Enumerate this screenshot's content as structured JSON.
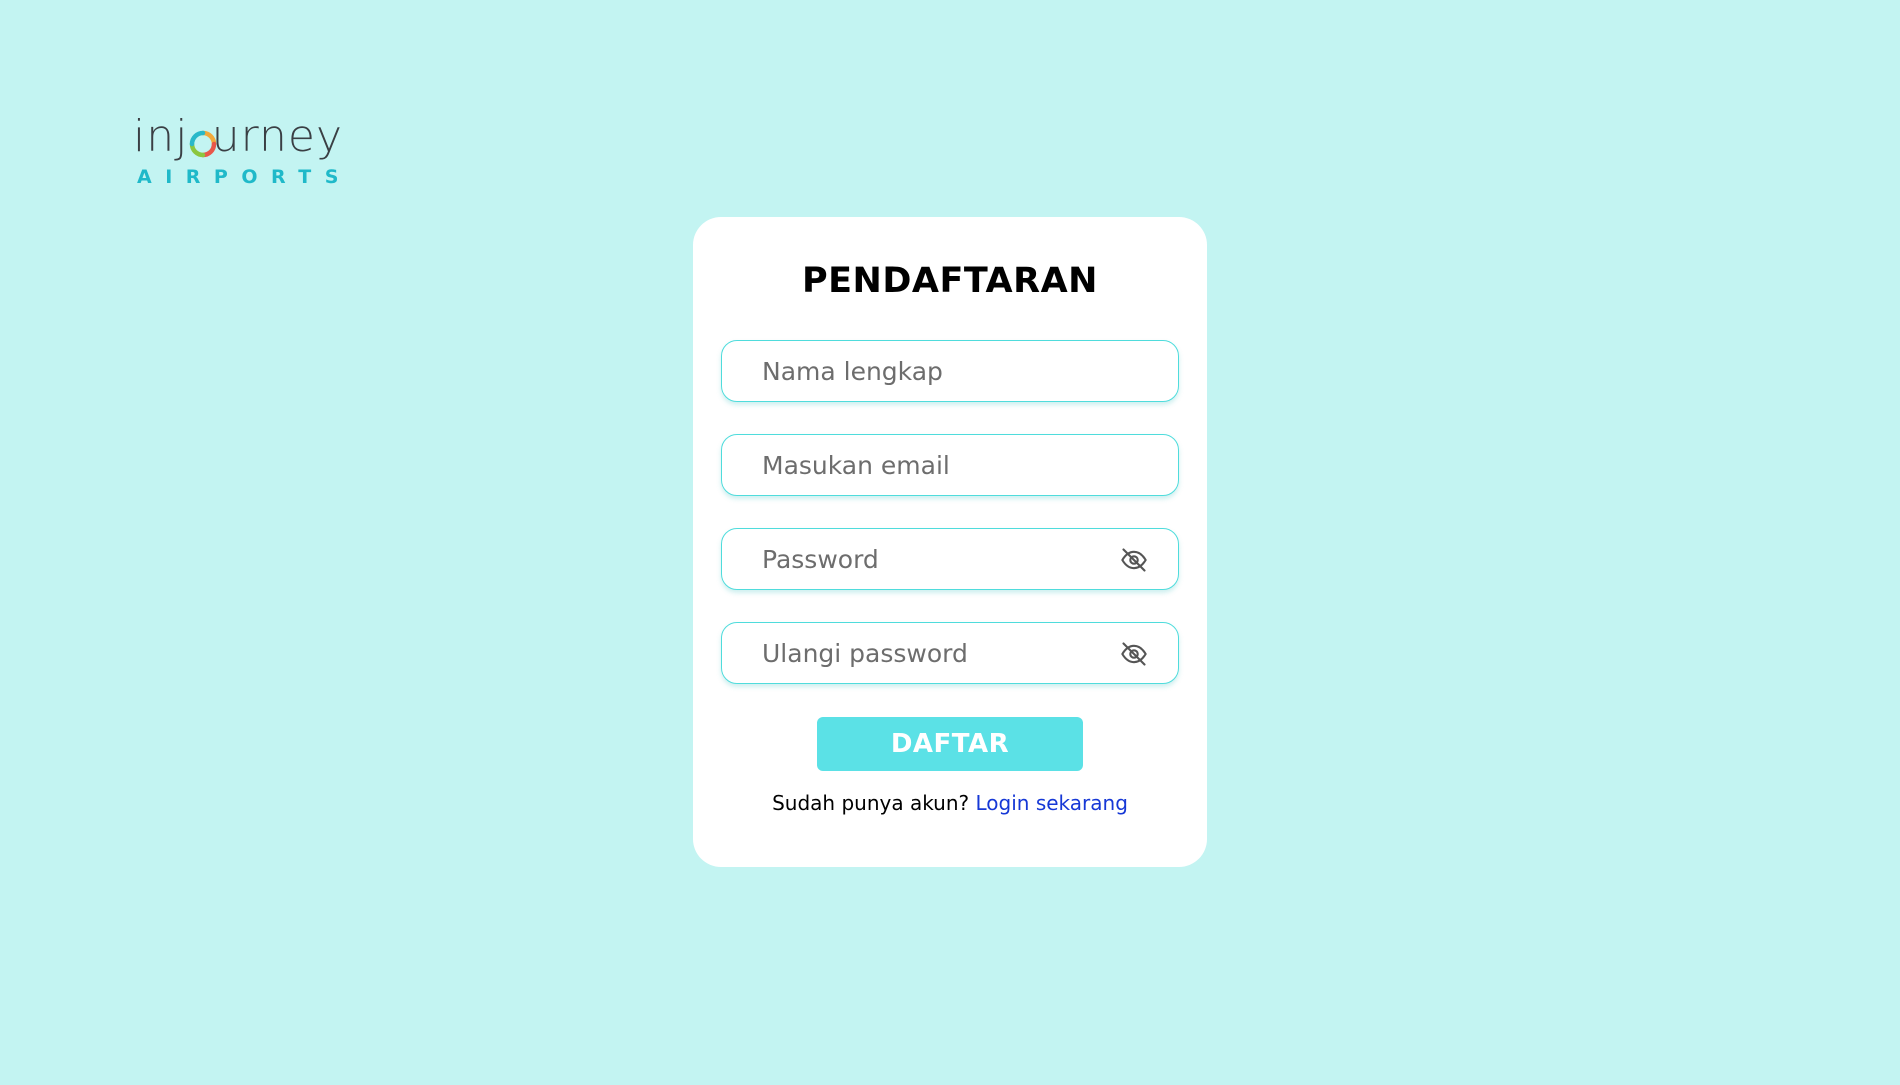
{
  "logo": {
    "word_pre": "inj",
    "word_post": "urney",
    "subtitle": "AIRPORTS",
    "icon": "injourney-ring-logo-icon"
  },
  "card": {
    "title": "PENDAFTARAN",
    "fields": {
      "full_name": {
        "placeholder": "Nama lengkap",
        "value": ""
      },
      "email": {
        "placeholder": "Masukan email",
        "value": ""
      },
      "password": {
        "placeholder": "Password",
        "value": "",
        "icon": "eye-off-icon"
      },
      "confirm_password": {
        "placeholder": "Ulangi password",
        "value": "",
        "icon": "eye-off-icon"
      }
    },
    "submit_label": "DAFTAR",
    "footer_text": "Sudah punya akun?",
    "footer_link": "Login sekarang"
  },
  "colors": {
    "background": "#c3f4f2",
    "accent": "#5be1e6",
    "field_border": "#4fdcdc",
    "link": "#1638d6",
    "logo_subtitle": "#1fb9c9"
  }
}
